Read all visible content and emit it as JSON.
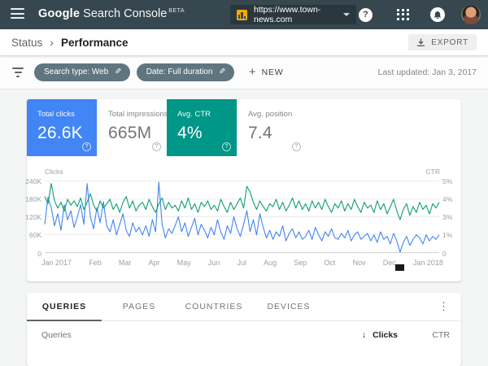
{
  "app_bar": {
    "logo": {
      "google": "Google",
      "rest": "Search Console",
      "beta": "BETA"
    },
    "property": {
      "url": "https://www.town-news.com"
    }
  },
  "breadcrumb": {
    "parent": "Status",
    "current": "Performance",
    "export_label": "EXPORT"
  },
  "filter_bar": {
    "chips": [
      {
        "label": "Search type: Web"
      },
      {
        "label": "Date: Full duration"
      }
    ],
    "new_label": "NEW",
    "last_updated": "Last updated: Jan 3, 2017"
  },
  "metrics": [
    {
      "label": "Total clicks",
      "value": "26.6K",
      "selected": true,
      "color": "#4285f4"
    },
    {
      "label": "Total impressions",
      "value": "665M",
      "selected": false,
      "color": "#ffffff"
    },
    {
      "label": "Avg. CTR",
      "value": "4%",
      "selected": true,
      "color": "#009688"
    },
    {
      "label": "Avg. position",
      "value": "7.4",
      "selected": false,
      "color": "#ffffff"
    }
  ],
  "chart_data": {
    "type": "line",
    "title": "Clicks and CTR over time",
    "x_axis": {
      "labels": [
        "Jan 2017",
        "Feb",
        "Mar",
        "Apr",
        "May",
        "Jun",
        "Jul",
        "Aug",
        "Sep",
        "Oct",
        "Nov",
        "Dec",
        "Jan 2018"
      ]
    },
    "left_axis": {
      "label": "Clicks",
      "ticks": [
        "240K",
        "180K",
        "120K",
        "60K",
        "0"
      ],
      "range": [
        0,
        240000
      ]
    },
    "right_axis": {
      "label": "CTR",
      "ticks": [
        "5%",
        "4%",
        "3%",
        "1%",
        "0"
      ],
      "range": [
        0,
        5
      ]
    },
    "grid": true,
    "legend_position": "none",
    "series": [
      {
        "name": "Clicks",
        "color": "#4285f4",
        "unit": "thousands",
        "axis_max": 240,
        "values": [
          95,
          185,
          150,
          90,
          130,
          75,
          160,
          110,
          140,
          85,
          120,
          160,
          95,
          230,
          120,
          80,
          150,
          100,
          170,
          90,
          70,
          110,
          60,
          95,
          130,
          75,
          55,
          100,
          70,
          85,
          60,
          90,
          55,
          110,
          70,
          235,
          95,
          50,
          80,
          65,
          90,
          120,
          70,
          100,
          55,
          85,
          115,
          60,
          95,
          75,
          50,
          85,
          60,
          110,
          70,
          45,
          90,
          65,
          120,
          80,
          55,
          95,
          140,
          70,
          110,
          60,
          130,
          85,
          50,
          75,
          45,
          70,
          55,
          90,
          40,
          65,
          80,
          50,
          70,
          45,
          55,
          75,
          45,
          85,
          60,
          40,
          70,
          55,
          80,
          50,
          45,
          65,
          50,
          75,
          40,
          60,
          70,
          45,
          55,
          65,
          40,
          60,
          35,
          70,
          45,
          55,
          30,
          65,
          40,
          3,
          35,
          55,
          25,
          45,
          60,
          50,
          30,
          60,
          40,
          55,
          45,
          60
        ]
      },
      {
        "name": "CTR",
        "color": "#0f9d75",
        "unit": "percent",
        "axis_max": 5,
        "values": [
          3.9,
          3.4,
          4.8,
          3.6,
          3.1,
          3.5,
          2.9,
          3.7,
          3.3,
          3.6,
          3.2,
          3.8,
          3.0,
          3.5,
          4.1,
          3.3,
          2.9,
          3.6,
          3.1,
          3.4,
          3.7,
          3.0,
          3.4,
          2.8,
          3.5,
          3.9,
          3.1,
          3.6,
          2.9,
          3.3,
          3.5,
          3.0,
          3.7,
          3.2,
          2.8,
          3.4,
          3.8,
          3.0,
          3.5,
          3.1,
          3.3,
          2.9,
          3.6,
          3.1,
          3.8,
          3.0,
          3.4,
          2.8,
          3.5,
          3.2,
          3.6,
          3.0,
          3.3,
          2.9,
          3.7,
          3.2,
          2.8,
          3.5,
          3.0,
          3.4,
          3.8,
          3.1,
          4.6,
          4.2,
          3.5,
          3.0,
          3.6,
          3.2,
          2.9,
          3.4,
          3.2,
          3.7,
          3.0,
          3.5,
          2.9,
          3.3,
          3.8,
          3.1,
          3.6,
          3.0,
          3.4,
          2.9,
          3.6,
          3.1,
          3.5,
          3.0,
          3.7,
          3.2,
          2.8,
          3.4,
          3.1,
          3.6,
          2.9,
          3.4,
          3.0,
          3.7,
          3.2,
          2.8,
          3.5,
          3.1,
          3.3,
          2.8,
          3.6,
          3.0,
          3.4,
          2.7,
          3.2,
          3.7,
          2.9,
          2.3,
          3.0,
          3.4,
          2.6,
          3.2,
          2.8,
          3.5,
          3.0,
          3.3,
          2.7,
          3.4,
          3.1,
          3.5
        ]
      }
    ]
  },
  "tabs": [
    "QUERIES",
    "PAGES",
    "COUNTRIES",
    "DEVICES"
  ],
  "table": {
    "col_queries": "Queries",
    "col_clicks": "Clicks",
    "col_ctr": "CTR"
  },
  "icons": {
    "help": "?",
    "pencil": "✎",
    "plus": "+",
    "sort_down": "↓",
    "menu_dots": "⋮"
  },
  "theme": {
    "appbar_bg": "#37474f",
    "accent_blue": "#4285f4",
    "accent_teal": "#009688",
    "property_icon": "#f9ab00"
  }
}
